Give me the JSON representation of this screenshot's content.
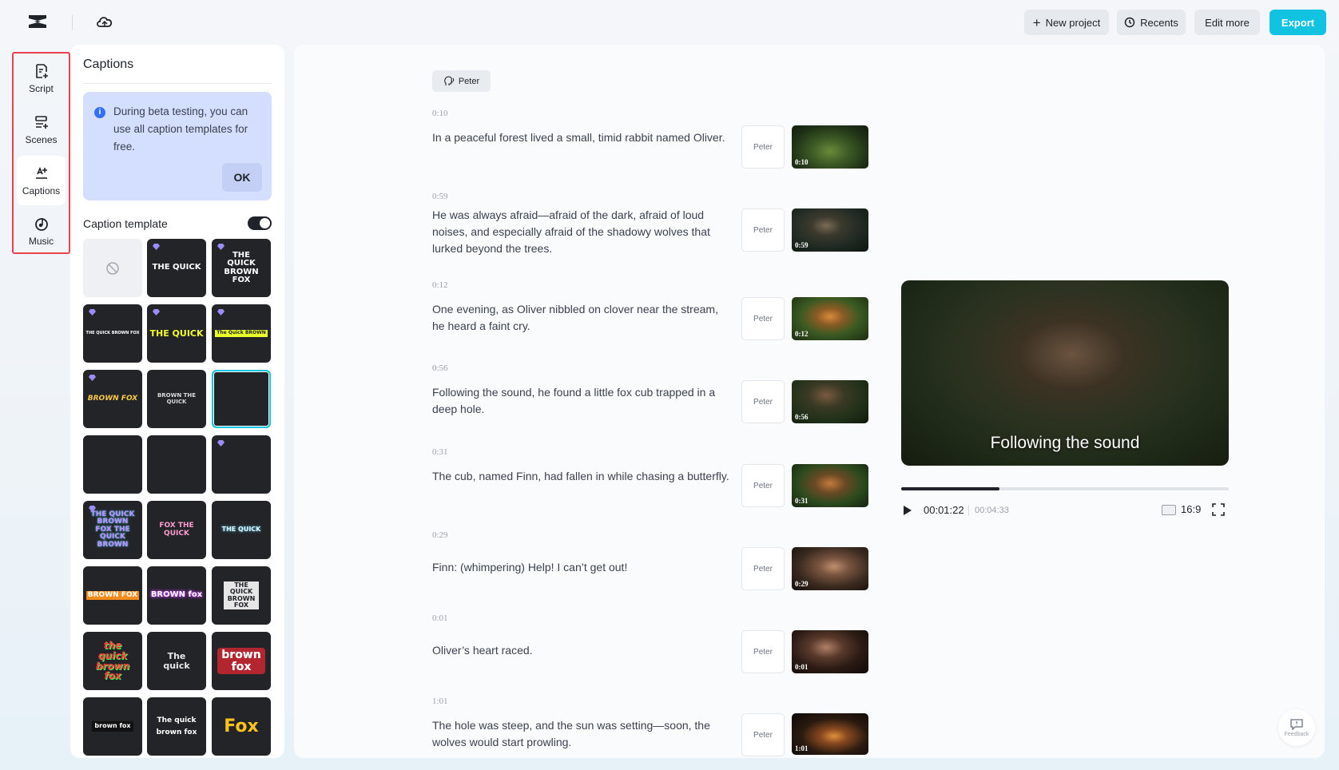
{
  "header": {
    "new_project": "New project",
    "recents": "Recents",
    "edit_more": "Edit more",
    "export": "Export"
  },
  "rail": {
    "items": [
      {
        "label": "Script",
        "icon": "script-icon"
      },
      {
        "label": "Scenes",
        "icon": "scenes-icon"
      },
      {
        "label": "Captions",
        "icon": "captions-icon",
        "active": true
      },
      {
        "label": "Music",
        "icon": "music-icon"
      }
    ]
  },
  "panel": {
    "title": "Captions",
    "beta_notice": "During beta testing, you can use all caption templates for free.",
    "ok": "OK",
    "template_label": "Caption template",
    "template_enabled": true,
    "tiles": [
      {
        "text": ""
      },
      {
        "text": "THE QUICK"
      },
      {
        "text": "THE QUICK BROWN FOX"
      },
      {
        "text": "THE QUICK BROWN FOX"
      },
      {
        "text": "THE QUICK"
      },
      {
        "text": "The Quick BROWN"
      },
      {
        "text": "BROWN FOX"
      },
      {
        "text": "BROWN THE QUICK"
      },
      {
        "text": ""
      },
      {
        "text": ""
      },
      {
        "text": ""
      },
      {
        "text": ""
      },
      {
        "text": "THE QUICK BROWN FOX THE QUICK BROWN"
      },
      {
        "text": "FOX THE QUICK"
      },
      {
        "text": "THE QUICK"
      },
      {
        "text": "BROWN FOX"
      },
      {
        "text": "BROWN fox"
      },
      {
        "text": "THE QUICK BROWN FOX"
      },
      {
        "text": "the quick brown fox"
      },
      {
        "text": "The quick"
      },
      {
        "text": "brown fox"
      },
      {
        "text": "brown fox"
      },
      {
        "text": "The quick brown fox"
      },
      {
        "text": "Fox"
      }
    ]
  },
  "script": {
    "speaker": "Peter",
    "lines": [
      {
        "ts": "0:10",
        "text": "In a peaceful forest lived a small, timid rabbit named Oliver.",
        "voice": "Peter",
        "thumb_ts": "0:10"
      },
      {
        "ts": "0:59",
        "text": "He was always afraid—afraid of the dark, afraid of loud noises, and especially afraid of the shadowy wolves that lurked beyond the trees.",
        "voice": "Peter",
        "thumb_ts": "0:59"
      },
      {
        "ts": "0:12",
        "text": "One evening, as Oliver nibbled on clover near the stream, he heard a faint cry.",
        "voice": "Peter",
        "thumb_ts": "0:12"
      },
      {
        "ts": "0:56",
        "text": "Following the sound, he found a little fox cub trapped in a deep hole.",
        "voice": "Peter",
        "thumb_ts": "0:56"
      },
      {
        "ts": "0:31",
        "text": "The cub, named Finn, had fallen in while chasing a butterfly.",
        "voice": "Peter",
        "thumb_ts": "0:31"
      },
      {
        "ts": "0:29",
        "text": "Finn: (whimpering) Help! I can’t get out!",
        "voice": "Peter",
        "thumb_ts": "0:29"
      },
      {
        "ts": "0:01",
        "text": "Oliver’s heart raced.",
        "voice": "Peter",
        "thumb_ts": "0:01"
      },
      {
        "ts": "1:01",
        "text": "The hole was steep, and the sun was setting—soon, the wolves would start prowling.",
        "voice": "Peter",
        "thumb_ts": "1:01"
      }
    ]
  },
  "player": {
    "caption": "Following the sound",
    "current_time": "00:01:22",
    "total_time": "00:04:33",
    "progress": 0.3,
    "ratio": "16:9"
  },
  "feedback": "Feedback",
  "colors": {
    "accent": "#11c3e0",
    "highlight_border": "#e8414f"
  }
}
